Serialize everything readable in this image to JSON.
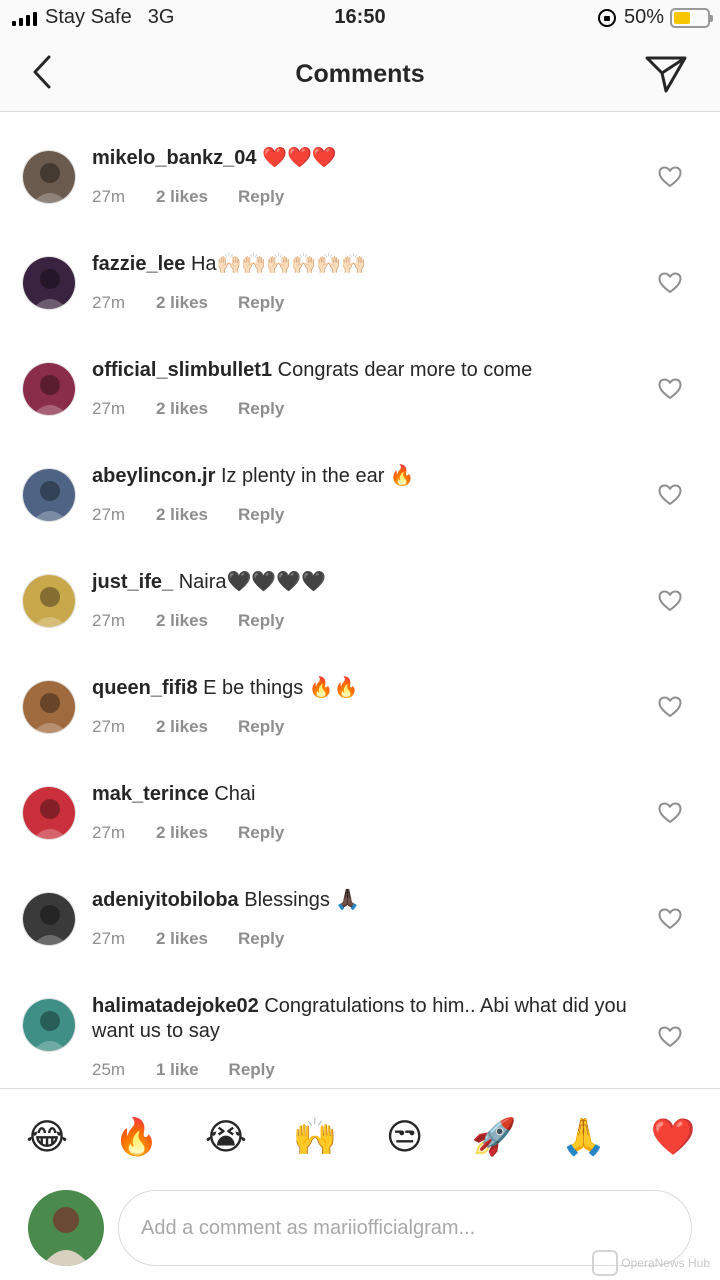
{
  "status_bar": {
    "carrier": "Stay Safe",
    "network": "3G",
    "time": "16:50",
    "battery": "50%",
    "battery_level": 0.5
  },
  "header": {
    "title": "Comments",
    "back_icon": "chevron-left-icon",
    "share_icon": "paper-plane-icon"
  },
  "comments": [
    {
      "username": "mikelo_bankz_04",
      "text": "❤️❤️❤️",
      "time": "27m",
      "likes": "2 likes",
      "reply": "Reply",
      "avatar_color": "#6b5a4e"
    },
    {
      "username": "fazzie_lee",
      "text": "Ha🙌🏻🙌🏻🙌🏻🙌🏻🙌🏻🙌🏻",
      "time": "27m",
      "likes": "2 likes",
      "reply": "Reply",
      "avatar_color": "#3a2340"
    },
    {
      "username": "official_slimbullet1",
      "text": "Congrats dear more to come",
      "time": "27m",
      "likes": "2 likes",
      "reply": "Reply",
      "avatar_color": "#8a2d4a"
    },
    {
      "username": "abeylincon.jr",
      "text": "Iz plenty in the ear 🔥",
      "time": "27m",
      "likes": "2 likes",
      "reply": "Reply",
      "avatar_color": "#4f6485"
    },
    {
      "username": "just_ife_",
      "text": "Naira🖤🖤🖤🖤",
      "time": "27m",
      "likes": "2 likes",
      "reply": "Reply",
      "avatar_color": "#c9a84b"
    },
    {
      "username": "queen_fifi8",
      "text": "E be things 🔥🔥",
      "time": "27m",
      "likes": "2 likes",
      "reply": "Reply",
      "avatar_color": "#a06a3f"
    },
    {
      "username": "mak_terince",
      "text": "Chai",
      "time": "27m",
      "likes": "2 likes",
      "reply": "Reply",
      "avatar_color": "#c9303b"
    },
    {
      "username": "adeniyitobiloba",
      "text": "Blessings 🙏🏿",
      "time": "27m",
      "likes": "2 likes",
      "reply": "Reply",
      "avatar_color": "#3a3a3a"
    },
    {
      "username": "halimatadejoke02",
      "text": "Congratulations to him.. Abi what did you want us to say",
      "time": "25m",
      "likes": "1 like",
      "reply": "Reply",
      "avatar_color": "#3f8f86"
    }
  ],
  "emoji_bar": [
    "😂",
    "🔥",
    "😭",
    "🙌",
    "😒",
    "🚀",
    "🙏",
    "❤️"
  ],
  "composer": {
    "placeholder": "Add a comment as mariiofficialgram...",
    "avatar_color": "#4a8a4c"
  },
  "watermark": "OperaNews Hub"
}
